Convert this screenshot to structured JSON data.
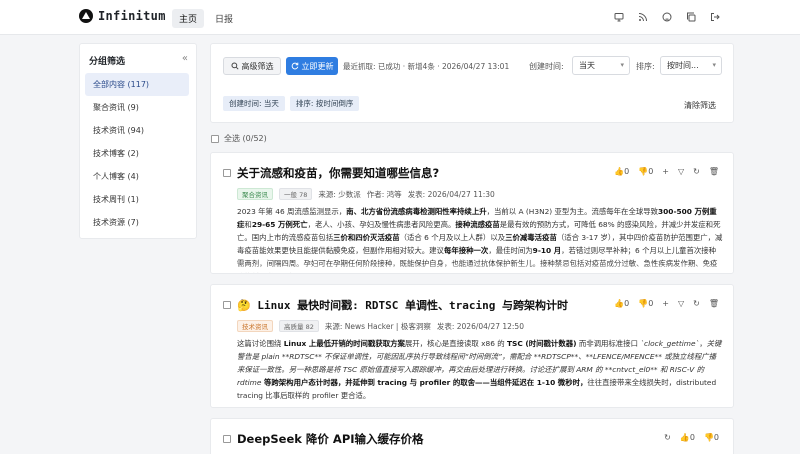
{
  "app": {
    "name": "Infinitum"
  },
  "nav": {
    "home": "主页",
    "daily": "日报"
  },
  "icons": {
    "monitor": "monitor-icon",
    "rss": "rss-icon",
    "github": "github-icon",
    "copy": "copy-icon",
    "logout": "logout-icon"
  },
  "sidebar": {
    "title": "分组筛选",
    "collapse": "«",
    "items": [
      {
        "label": "全部内容 (117)",
        "active": true
      },
      {
        "label": "聚合资讯 (9)"
      },
      {
        "label": "技术资讯 (94)"
      },
      {
        "label": "技术博客 (2)"
      },
      {
        "label": "个人博客 (4)"
      },
      {
        "label": "技术周刊 (1)"
      },
      {
        "label": "技术资源 (7)"
      }
    ]
  },
  "filters": {
    "advanced": "高级筛选",
    "update": "立即更新",
    "fetch_status": "最近抓取: 已成功 · 新增4条 · 2026/04/27 13:01",
    "created_label": "创建时间:",
    "created_value": "当天",
    "sort_label": "排序:",
    "sort_value": "按时间...",
    "chips": [
      "创建时间: 当天",
      "排序: 按时间倒序"
    ],
    "clear": "清除筛选"
  },
  "select_all": "全选 (0/52)",
  "cards": [
    {
      "title": "关于流感和疫苗，你需要知道哪些信息?",
      "up": "0",
      "down": "0",
      "tag": "聚合资讯",
      "level": "一般 78",
      "source": "来源: 少数派",
      "author": "作者: 鸿等",
      "published": "发表: 2026/04/27 11:30",
      "body": [
        {
          "t": "2023 年第 46 周流感监测显示，"
        },
        {
          "t": "南、北方省份流感病毒检测阳性率持续上升",
          "b": true
        },
        {
          "t": "，当前以 A (H3N2) 亚型为主。流感每年在全球导致"
        },
        {
          "t": "300-500 万例重症",
          "b": true
        },
        {
          "t": "和"
        },
        {
          "t": "29-65 万例死亡",
          "b": true
        },
        {
          "t": "，老人、小孩、孕妇及慢性病患者风险更高。"
        },
        {
          "t": "接种流感疫苗",
          "b": true
        },
        {
          "t": "是最有效的预防方式，可降低 68% 的感染风险，并减少并发症和死亡。国内上市的流感疫苗包括"
        },
        {
          "t": "三价和四价灭活疫苗",
          "b": true
        },
        {
          "t": "（适合 6 个月及以上人群）以及"
        },
        {
          "t": "三价减毒活疫苗",
          "b": true
        },
        {
          "t": "（适合 3-17 岁），其中四价疫苗防护范围更广，减毒疫苗能效果更快且能提供黏膜免疫，但副作用相对较大。建议"
        },
        {
          "t": "每年接种一次",
          "b": true
        },
        {
          "t": "，最佳时间为"
        },
        {
          "t": "9-10 月",
          "b": true
        },
        {
          "t": "，若错过则尽早补种；6 个月以上儿童首次接种需两剂，间隔四周。孕妇可在孕期任何阶段接种，既能保护自身，也能通过抗体保护新生儿。接种禁忌包括对疫苗成分过敏、急性疾病发作期、免疫功能低下者及孕妇..."
        }
      ]
    },
    {
      "emoji": "🤔",
      "title": "Linux 最快时间戳: RDTSC 单调性、tracing 与跨架构计时",
      "up": "0",
      "down": "0",
      "tag": "技术资讯",
      "level": "高质量 82",
      "source": "来源: News Hacker | 极客洞察",
      "published": "发表: 2026/04/27 12:50",
      "body": [
        {
          "t": "这篇讨论围绕 "
        },
        {
          "t": "Linux 上最低开销的时间戳获取方案",
          "b": true
        },
        {
          "t": "展开，核心是直接读取 x86 的 "
        },
        {
          "t": "TSC (时间戳计数器)",
          "b": true
        },
        {
          "t": " 而非调用标准接口 "
        },
        {
          "t": "`clock_gettime`",
          "i": true
        },
        {
          "t": "，"
        },
        {
          "t": "关键警告是 plain **RDTSC** 不保证单调性，可能因乱序执行导致线程间“时间倒流”，需配合 **RDTSCP**、**LFENCE/MFENCE** 或独立线程广播来保证一致性。另一种思路是将 TSC 原始值直接写入跟踪缓冲，再交由后处理进行转换。讨论还扩展到 ARM 的 **cntvct_el0** 和 RISC-V 的 rdtime",
          "i": true
        },
        {
          "t": " 等跨架构用户态计时器，并延伸到 tracing 与 profiler 的取舍——当组件延迟在 1-10 微秒时，",
          "b": true
        },
        {
          "t": "往往直接带来全线损失时，distributed tracing 比事后取样的 profiler 更合适。"
        }
      ]
    },
    {
      "title": "DeepSeek 降价 API输入缓存价格",
      "up": "0",
      "down": "0"
    }
  ]
}
